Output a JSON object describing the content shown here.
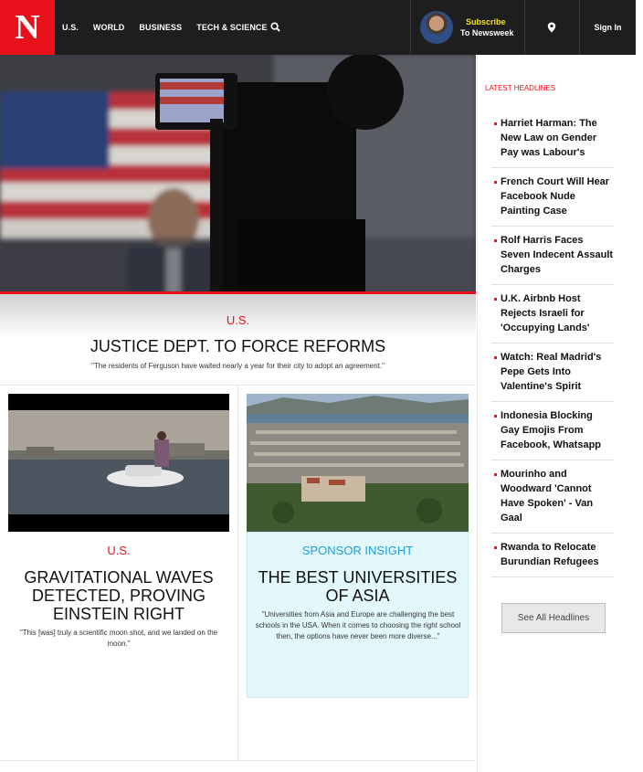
{
  "nav": {
    "logo": "N",
    "items": [
      "U.S.",
      "WORLD",
      "BUSINESS",
      "TECH & SCIENCE"
    ],
    "subscribe_line1": "Subscribe",
    "subscribe_line2": "To Newsweek",
    "signin": "Sign In",
    "icons": [
      "search-icon",
      "location-pin-icon"
    ]
  },
  "hero": {
    "category": "U.S.",
    "title": "JUSTICE DEPT. TO FORCE REFORMS",
    "dek": "\"The residents of Ferguson have waited nearly a year for their city to adopt an agreement.\""
  },
  "cards": [
    {
      "category": "U.S.",
      "title": "GRAVITATIONAL WAVES DETECTED, PROVING EINSTEIN RIGHT",
      "dek": "\"This [was] truly a scientific moon shot, and we landed on the moon.\""
    },
    {
      "category": "SPONSOR INSIGHT",
      "title": "THE BEST UNIVERSITIES OF ASIA",
      "dek": "\"Universities from Asia and Europe are challenging the best schools in the USA. When it comes to choosing the right school then, the options have never been more diverse...\""
    }
  ],
  "sidebar": {
    "title": "LATEST HEADLINES",
    "headlines": [
      "Harriet Harman: The New Law on Gender Pay was Labour's",
      "French Court Will Hear Facebook Nude Painting Case",
      "Rolf Harris Faces Seven Indecent Assault Charges",
      "U.K. Airbnb Host Rejects Israeli for 'Occupying Lands'",
      "Watch: Real Madrid's Pepe Gets Into Valentine's Spirit",
      "Indonesia Blocking Gay Emojis From Facebook, Whatsapp",
      "Mourinho and Woodward 'Cannot Have Spoken' - Van Gaal",
      "Rwanda to Relocate Burundian Refugees"
    ],
    "see_all": "See All Headlines"
  },
  "colors": {
    "brand_red": "#e8101a",
    "nav_bg": "#1e1e1e",
    "subscribe_yellow": "#f5e31c",
    "sponsor_blue": "#1a9fd6",
    "sponsor_bg": "#e2f8fb"
  }
}
